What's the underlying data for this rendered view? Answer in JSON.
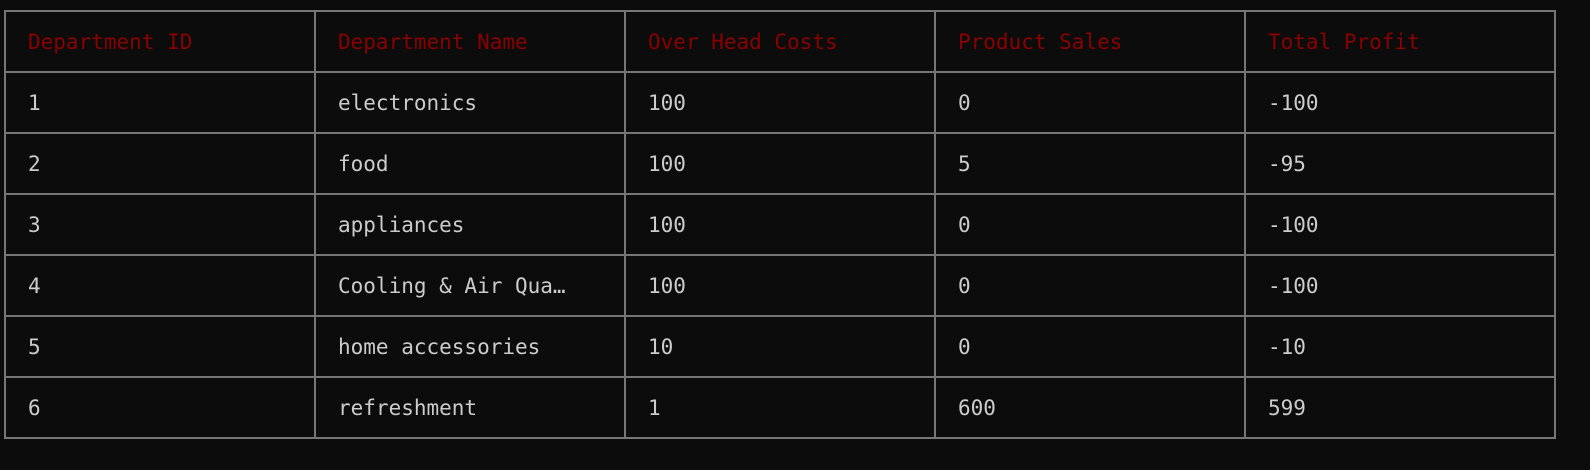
{
  "headers": [
    "Department ID",
    "Department Name",
    "Over Head Costs",
    "Product Sales",
    "Total Profit"
  ],
  "rows": [
    [
      "1",
      "electronics",
      "100",
      "0",
      "-100"
    ],
    [
      "2",
      "food",
      "100",
      "5",
      "-95"
    ],
    [
      "3",
      "appliances",
      "100",
      "0",
      "-100"
    ],
    [
      "4",
      "Cooling & Air Qua…",
      "100",
      "0",
      "-100"
    ],
    [
      "5",
      "home accessories",
      "10",
      "0",
      "-10"
    ],
    [
      "6",
      "refreshment",
      "1",
      "600",
      "599"
    ]
  ],
  "colors": {
    "header": "#8b0000",
    "text": "#cccccc",
    "border": "#767676",
    "background": "#0c0c0c"
  }
}
